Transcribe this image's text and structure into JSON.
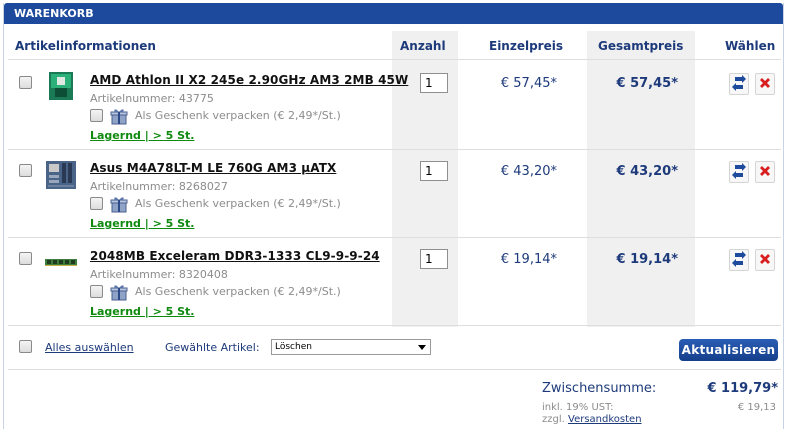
{
  "header": {
    "title": "WARENKORB"
  },
  "columns": {
    "info": "Artikelinformationen",
    "qty": "Anzahl",
    "unit": "Einzelpreis",
    "total": "Gesamtpreis",
    "select": "Wählen"
  },
  "items": [
    {
      "name": "AMD Athlon II X2 245e 2.90GHz AM3 2MB 45W",
      "article_number": "Artikelnummer: 43775",
      "gift_text": "Als Geschenk verpacken (€ 2,49*/St.)",
      "stock": "Lagernd | > 5 St.",
      "quantity": "1",
      "unit_price": "€ 57,45*",
      "total_price": "€ 57,45*",
      "thumb": "cpu-box-icon"
    },
    {
      "name": "Asus M4A78LT-M LE 760G AM3 µATX",
      "article_number": "Artikelnummer: 8268027",
      "gift_text": "Als Geschenk verpacken (€ 2,49*/St.)",
      "stock": "Lagernd | > 5 St.",
      "quantity": "1",
      "unit_price": "€ 43,20*",
      "total_price": "€ 43,20*",
      "thumb": "motherboard-icon"
    },
    {
      "name": "2048MB Exceleram DDR3-1333 CL9-9-9-24",
      "article_number": "Artikelnummer: 8320408",
      "gift_text": "Als Geschenk verpacken (€ 2,49*/St.)",
      "stock": "Lagernd | > 5 St.",
      "quantity": "1",
      "unit_price": "€ 19,14*",
      "total_price": "€ 19,14*",
      "thumb": "ram-module-icon"
    }
  ],
  "footer": {
    "select_all": "Alles auswählen",
    "selected_label": "Gewählte Artikel:",
    "action_value": "Löschen",
    "update_button": "Aktualisieren"
  },
  "summary": {
    "subtotal_label": "Zwischensumme:",
    "subtotal_value": "€ 119,79*",
    "vat_label": "inkl. 19% UST:",
    "vat_value": "€ 19,13",
    "shipping_prefix": "zzgl.",
    "shipping_link": "Versandkosten"
  },
  "colors": {
    "accent": "#1d4a9c",
    "text": "#1d3a7a",
    "stock": "#0f8a0f",
    "delete": "#d81e1e"
  }
}
